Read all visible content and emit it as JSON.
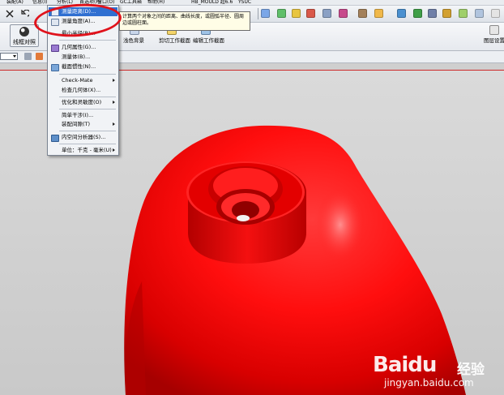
{
  "menubar": {
    "items": [
      "装配(A)",
      "信息(I)",
      "分析(L)",
      "首选项(P)",
      "窗口(O)",
      "GC工具箱",
      "帮助(H)",
      "HB_MOULD 超6.6",
      "YSUC"
    ]
  },
  "ribbon": {
    "render_style_label": "线框对照",
    "shaded_bg_label": "浅色背景",
    "clip_section_label": "剪切工作截面",
    "edit_section_label": "编辑工作截面",
    "view_settings_label": "图层设置"
  },
  "analysis_menu": {
    "items": [
      {
        "label": "测量距离(D)...",
        "icon": "ruler-icon",
        "active": true,
        "submenu": false
      },
      {
        "label": "测量角度(A)...",
        "icon": "angle-icon",
        "active": false,
        "submenu": false
      },
      {
        "label": "最小半径(R)...",
        "icon": "",
        "active": false,
        "submenu": false
      },
      {
        "label": "几何属性(G)...",
        "icon": "geometry-icon",
        "active": false,
        "submenu": false
      },
      {
        "label": "测量体(B)...",
        "icon": "",
        "active": false,
        "submenu": false
      },
      {
        "label": "截面惯性(N)...",
        "icon": "inertia-icon",
        "active": false,
        "submenu": false
      },
      {
        "label": "Check-Mate",
        "icon": "",
        "active": false,
        "submenu": true
      },
      {
        "label": "检查几何体(X)...",
        "icon": "",
        "active": false,
        "submenu": false
      },
      {
        "label": "优化和灵敏度(O)",
        "icon": "",
        "active": false,
        "submenu": true
      },
      {
        "label": "简单干涉(I)...",
        "icon": "",
        "active": false,
        "submenu": false
      },
      {
        "label": "装配间隙(T)",
        "icon": "",
        "active": false,
        "submenu": true
      },
      {
        "label": "内空间分析器(S)...",
        "icon": "analyzer-icon",
        "active": false,
        "submenu": false
      },
      {
        "label": "单位：千克 - 毫米(U)",
        "icon": "",
        "active": false,
        "submenu": true
      }
    ]
  },
  "tooltip": {
    "text": "计算两个对象之间的距离、曲线长度，或圆弧半径、圆周边或圆柱面。"
  },
  "watermark": {
    "logo": "Baidu",
    "cn": "经验",
    "url": "jingyan.baidu.com"
  },
  "colors": {
    "part": "#ff1010",
    "callout": "#e0121b",
    "menu_highlight": "#2f6fd1"
  }
}
